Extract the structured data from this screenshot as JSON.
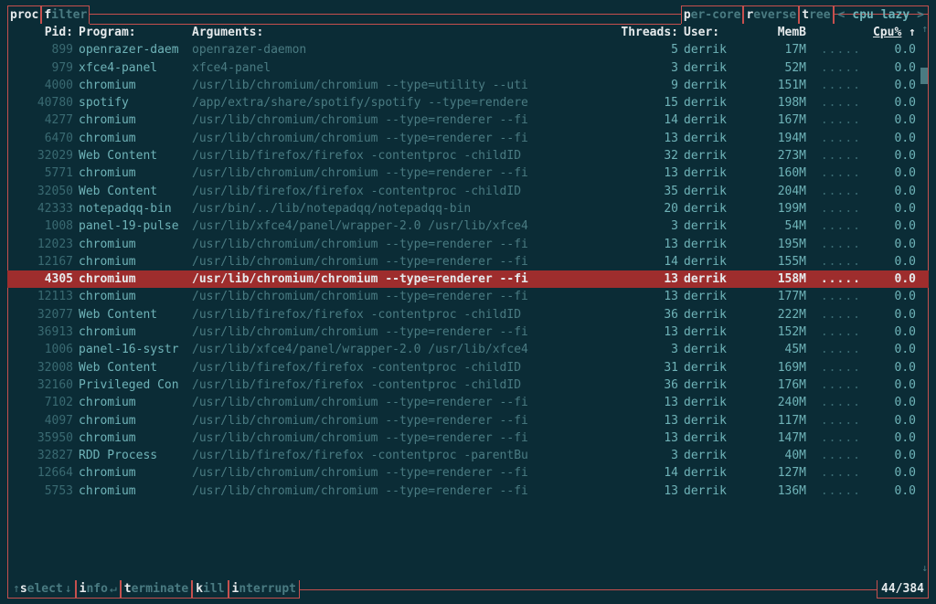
{
  "top_tabs_left": [
    {
      "key": "p",
      "rest": "roc",
      "active": true
    },
    {
      "key": "f",
      "rest": "ilter",
      "active": false
    }
  ],
  "top_tabs_right": [
    {
      "key": "p",
      "rest": "er-core"
    },
    {
      "key": "r",
      "rest": "everse"
    },
    {
      "key": "t",
      "rest": "ree"
    }
  ],
  "status": {
    "lt": "<",
    "a": "cpu",
    "b": "lazy",
    "gt": ">"
  },
  "headers": {
    "pid": "Pid:",
    "prog": "Program:",
    "args": "Arguments:",
    "thr": "Threads:",
    "user": "User:",
    "mem": "MemB",
    "cpu": "Cpu%",
    "sort_arrow": "↑"
  },
  "dots": ".....",
  "rows": [
    {
      "pid": "899",
      "prog": "openrazer-daem",
      "args": "openrazer-daemon",
      "thr": "5",
      "user": "derrik",
      "mem": "17M",
      "cpu": "0.0"
    },
    {
      "pid": "979",
      "prog": "xfce4-panel",
      "args": "xfce4-panel",
      "thr": "3",
      "user": "derrik",
      "mem": "52M",
      "cpu": "0.0"
    },
    {
      "pid": "4000",
      "prog": "chromium",
      "args": "/usr/lib/chromium/chromium --type=utility --uti",
      "thr": "9",
      "user": "derrik",
      "mem": "151M",
      "cpu": "0.0"
    },
    {
      "pid": "40780",
      "prog": "spotify",
      "args": "/app/extra/share/spotify/spotify --type=rendere",
      "thr": "15",
      "user": "derrik",
      "mem": "198M",
      "cpu": "0.0"
    },
    {
      "pid": "4277",
      "prog": "chromium",
      "args": "/usr/lib/chromium/chromium --type=renderer --fi",
      "thr": "14",
      "user": "derrik",
      "mem": "167M",
      "cpu": "0.0"
    },
    {
      "pid": "6470",
      "prog": "chromium",
      "args": "/usr/lib/chromium/chromium --type=renderer --fi",
      "thr": "13",
      "user": "derrik",
      "mem": "194M",
      "cpu": "0.0"
    },
    {
      "pid": "32029",
      "prog": "Web Content",
      "args": "/usr/lib/firefox/firefox -contentproc -childID",
      "thr": "32",
      "user": "derrik",
      "mem": "273M",
      "cpu": "0.0"
    },
    {
      "pid": "5771",
      "prog": "chromium",
      "args": "/usr/lib/chromium/chromium --type=renderer --fi",
      "thr": "13",
      "user": "derrik",
      "mem": "160M",
      "cpu": "0.0"
    },
    {
      "pid": "32050",
      "prog": "Web Content",
      "args": "/usr/lib/firefox/firefox -contentproc -childID",
      "thr": "35",
      "user": "derrik",
      "mem": "204M",
      "cpu": "0.0"
    },
    {
      "pid": "42333",
      "prog": "notepadqq-bin",
      "args": "/usr/bin/../lib/notepadqq/notepadqq-bin",
      "thr": "20",
      "user": "derrik",
      "mem": "199M",
      "cpu": "0.0"
    },
    {
      "pid": "1008",
      "prog": "panel-19-pulse",
      "args": "/usr/lib/xfce4/panel/wrapper-2.0 /usr/lib/xfce4",
      "thr": "3",
      "user": "derrik",
      "mem": "54M",
      "cpu": "0.0"
    },
    {
      "pid": "12023",
      "prog": "chromium",
      "args": "/usr/lib/chromium/chromium --type=renderer --fi",
      "thr": "13",
      "user": "derrik",
      "mem": "195M",
      "cpu": "0.0"
    },
    {
      "pid": "12167",
      "prog": "chromium",
      "args": "/usr/lib/chromium/chromium --type=renderer --fi",
      "thr": "14",
      "user": "derrik",
      "mem": "155M",
      "cpu": "0.0"
    },
    {
      "pid": "4305",
      "prog": "chromium",
      "args": "/usr/lib/chromium/chromium --type=renderer --fi",
      "thr": "13",
      "user": "derrik",
      "mem": "158M",
      "cpu": "0.0",
      "selected": true
    },
    {
      "pid": "12113",
      "prog": "chromium",
      "args": "/usr/lib/chromium/chromium --type=renderer --fi",
      "thr": "13",
      "user": "derrik",
      "mem": "177M",
      "cpu": "0.0"
    },
    {
      "pid": "32077",
      "prog": "Web Content",
      "args": "/usr/lib/firefox/firefox -contentproc -childID",
      "thr": "36",
      "user": "derrik",
      "mem": "222M",
      "cpu": "0.0"
    },
    {
      "pid": "36913",
      "prog": "chromium",
      "args": "/usr/lib/chromium/chromium --type=renderer --fi",
      "thr": "13",
      "user": "derrik",
      "mem": "152M",
      "cpu": "0.0"
    },
    {
      "pid": "1006",
      "prog": "panel-16-systr",
      "args": "/usr/lib/xfce4/panel/wrapper-2.0 /usr/lib/xfce4",
      "thr": "3",
      "user": "derrik",
      "mem": "45M",
      "cpu": "0.0"
    },
    {
      "pid": "32008",
      "prog": "Web Content",
      "args": "/usr/lib/firefox/firefox -contentproc -childID",
      "thr": "31",
      "user": "derrik",
      "mem": "169M",
      "cpu": "0.0"
    },
    {
      "pid": "32160",
      "prog": "Privileged Con",
      "args": "/usr/lib/firefox/firefox -contentproc -childID",
      "thr": "36",
      "user": "derrik",
      "mem": "176M",
      "cpu": "0.0"
    },
    {
      "pid": "7102",
      "prog": "chromium",
      "args": "/usr/lib/chromium/chromium --type=renderer --fi",
      "thr": "13",
      "user": "derrik",
      "mem": "240M",
      "cpu": "0.0"
    },
    {
      "pid": "4097",
      "prog": "chromium",
      "args": "/usr/lib/chromium/chromium --type=renderer --fi",
      "thr": "13",
      "user": "derrik",
      "mem": "117M",
      "cpu": "0.0"
    },
    {
      "pid": "35950",
      "prog": "chromium",
      "args": "/usr/lib/chromium/chromium --type=renderer --fi",
      "thr": "13",
      "user": "derrik",
      "mem": "147M",
      "cpu": "0.0"
    },
    {
      "pid": "32827",
      "prog": "RDD Process",
      "args": "/usr/lib/firefox/firefox -contentproc -parentBu",
      "thr": "3",
      "user": "derrik",
      "mem": "40M",
      "cpu": "0.0"
    },
    {
      "pid": "12664",
      "prog": "chromium",
      "args": "/usr/lib/chromium/chromium --type=renderer --fi",
      "thr": "14",
      "user": "derrik",
      "mem": "127M",
      "cpu": "0.0"
    },
    {
      "pid": "5753",
      "prog": "chromium",
      "args": "/usr/lib/chromium/chromium --type=renderer --fi",
      "thr": "13",
      "user": "derrik",
      "mem": "136M",
      "cpu": "0.0"
    }
  ],
  "footer": [
    {
      "arrow": "↑",
      "key": "s",
      "rest": "elect",
      "arrow2": "↓"
    },
    {
      "key": "i",
      "rest": "nfo",
      "arrow2": "↵"
    },
    {
      "key": "t",
      "rest": "erminate"
    },
    {
      "key": "k",
      "rest": "ill"
    },
    {
      "key": "i",
      "rest": "nterrupt"
    }
  ],
  "counter": "44/384"
}
